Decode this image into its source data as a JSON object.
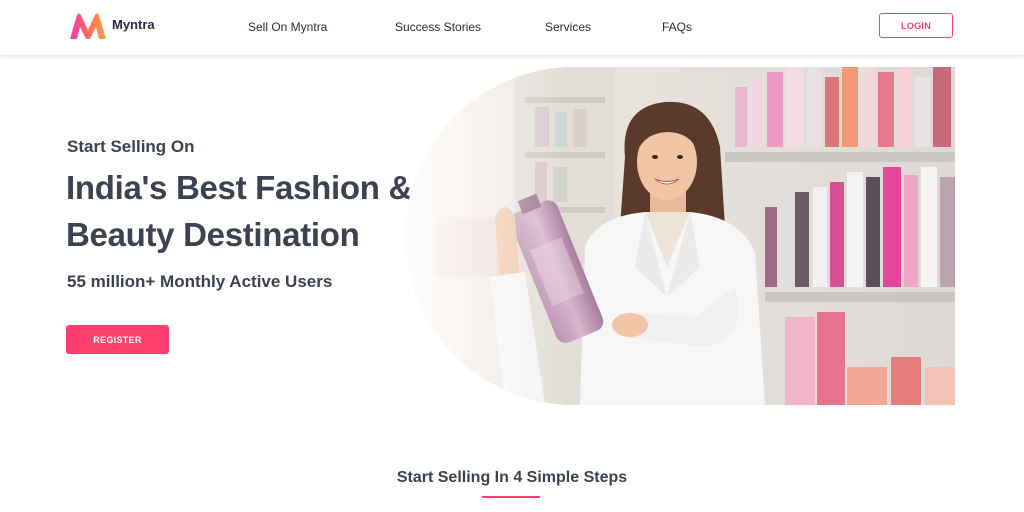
{
  "header": {
    "brand": "Myntra",
    "nav": [
      "Sell On Myntra",
      "Success Stories",
      "Services",
      "FAQs"
    ],
    "login_label": "LOGIN"
  },
  "hero": {
    "subtitle": "Start Selling On",
    "title": "India's Best Fashion & Beauty Destination",
    "stat": "55 million+ Monthly Active Users",
    "register_label": "REGISTER"
  },
  "steps": {
    "heading": "Start Selling In 4 Simple Steps"
  },
  "colors": {
    "accent": "#ff3f6c",
    "text": "#3e4152"
  },
  "icons": {
    "logo": "myntra-logo-icon"
  }
}
